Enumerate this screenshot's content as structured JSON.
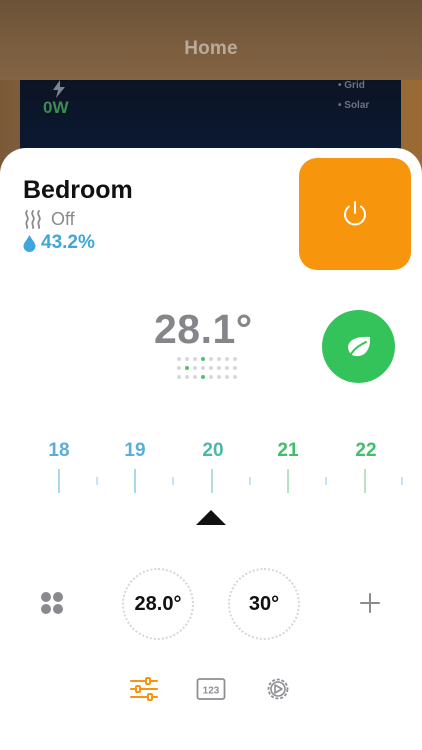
{
  "background": {
    "title": "Home",
    "power_value": "0W",
    "legend": [
      "Grid",
      "Solar"
    ]
  },
  "room": {
    "name": "Bedroom",
    "mode": "Off",
    "humidity": "43.2%"
  },
  "thermostat": {
    "current_temp": "28.1°",
    "scale_labels": [
      "18",
      "19",
      "20",
      "21",
      "22"
    ],
    "setpoint_low": "28.0°",
    "setpoint_high": "30°"
  },
  "colors": {
    "power_button": "#f7960c",
    "eco_button": "#34c35a",
    "humidity": "#3ea6dd",
    "scale_blue": "#5aaed8",
    "scale_green": "#3fbf6a",
    "tab_active": "#f7960c",
    "tab_inactive": "#8e8e93"
  },
  "icons": {
    "power": "power-icon",
    "eco": "leaf-icon",
    "heat": "heat-waves-icon",
    "humidity": "water-drop-icon",
    "presets": "four-dots-icon",
    "add": "plus-icon",
    "tabs": [
      "sliders-icon",
      "numeric-keypad-icon",
      "settings-gear-icon"
    ]
  }
}
